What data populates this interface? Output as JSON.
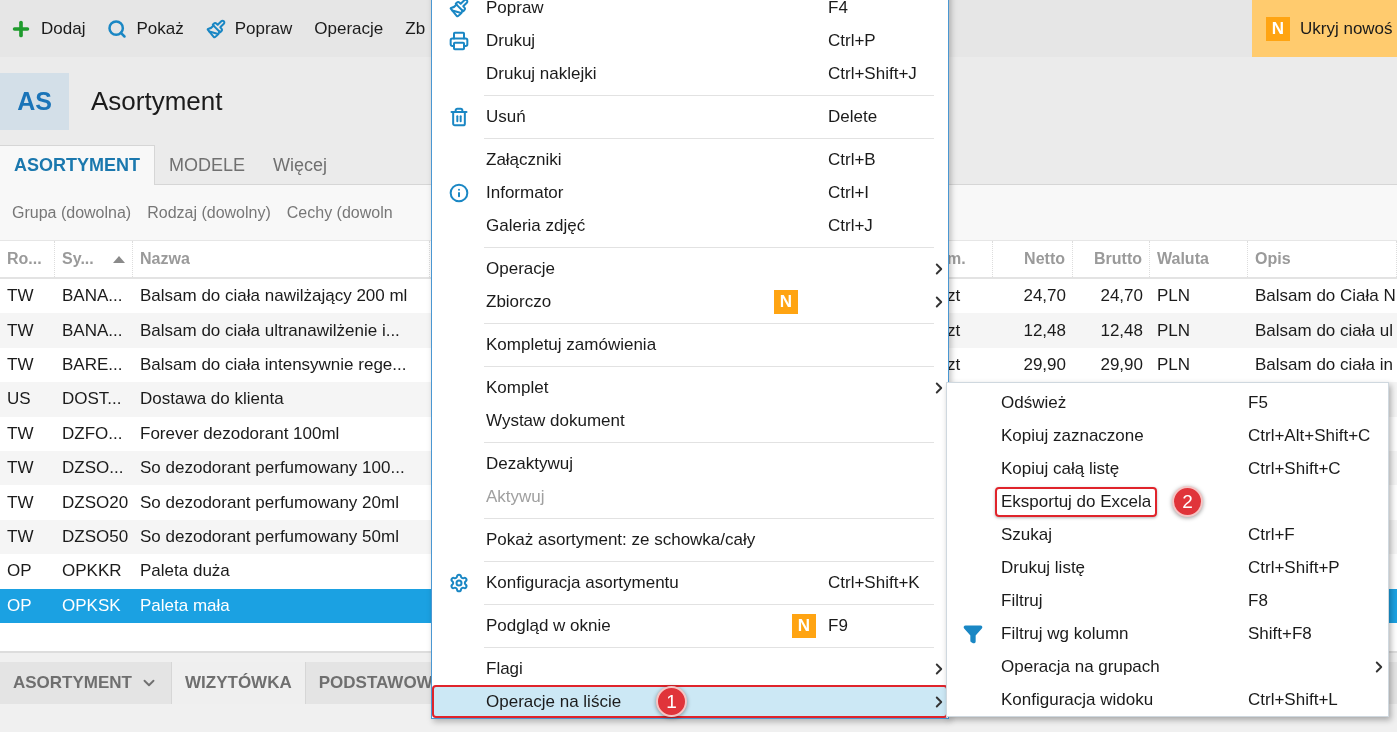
{
  "toolbar": {
    "items": [
      {
        "label": "Dodaj"
      },
      {
        "label": "Pokaż"
      },
      {
        "label": "Popraw"
      },
      {
        "label": "Operacje"
      },
      {
        "label": "Zb"
      }
    ],
    "news_button": {
      "badge": "N",
      "label": "Ukryj nowoś"
    }
  },
  "header": {
    "badge": "AS",
    "title": "Asortyment"
  },
  "tabs": [
    {
      "label": "ASORTYMENT",
      "selected": true
    },
    {
      "label": "MODELE",
      "selected": false
    },
    {
      "label": "Więcej",
      "selected": false
    }
  ],
  "filters": [
    "Grupa (dowolna)",
    "Rodzaj (dowolny)",
    "Cechy (dowoln"
  ],
  "table": {
    "columns": [
      {
        "label": "Ro...",
        "sorted": false
      },
      {
        "label": "Sy...",
        "sorted": true
      },
      {
        "label": "Nazwa",
        "sorted": false
      },
      {
        "label": "m.",
        "sorted": false
      },
      {
        "label": "Netto",
        "sorted": false
      },
      {
        "label": "Brutto",
        "sorted": false
      },
      {
        "label": "Waluta",
        "sorted": false
      },
      {
        "label": "Opis",
        "sorted": false
      }
    ],
    "rows": [
      {
        "selected": false,
        "cells": [
          "TW",
          "BANA...",
          "Balsam do ciała nawilżający 200 ml",
          "zt",
          "24,70",
          "24,70",
          "PLN",
          "Balsam do Ciała N"
        ]
      },
      {
        "selected": false,
        "cells": [
          "TW",
          "BANA...",
          "Balsam do ciała ultranawilżenie i...",
          "zt",
          "12,48",
          "12,48",
          "PLN",
          "Balsam do ciała ul"
        ]
      },
      {
        "selected": false,
        "cells": [
          "TW",
          "BARE...",
          "Balsam do ciała intensywnie rege...",
          "zt",
          "29,90",
          "29,90",
          "PLN",
          "Balsam do ciała in"
        ]
      },
      {
        "selected": false,
        "cells": [
          "US",
          "DOST...",
          "Dostawa do klienta"
        ]
      },
      {
        "selected": false,
        "cells": [
          "TW",
          "DZFO...",
          "Forever dezodorant 100ml"
        ]
      },
      {
        "selected": false,
        "cells": [
          "TW",
          "DZSO...",
          "So dezodorant perfumowany 100..."
        ]
      },
      {
        "selected": false,
        "cells": [
          "TW",
          "DZSO20",
          "So dezodorant perfumowany 20ml"
        ]
      },
      {
        "selected": false,
        "cells": [
          "TW",
          "DZSO50",
          "So dezodorant perfumowany 50ml"
        ]
      },
      {
        "selected": false,
        "cells": [
          "OP",
          "OPKKR",
          "Paleta duża"
        ]
      },
      {
        "selected": true,
        "cells": [
          "OP",
          "OPKSK",
          "Paleta mała"
        ]
      }
    ]
  },
  "bottom_tabs": [
    {
      "label": "ASORTYMENT",
      "dropdown": true,
      "selected": false
    },
    {
      "label": "WIZYTÓWKA",
      "dropdown": false,
      "selected": true
    },
    {
      "label": "PODSTAWOW",
      "dropdown": false,
      "selected": false
    }
  ],
  "context_menu": {
    "items": [
      {
        "kind": "item",
        "label": "Popraw",
        "shortcut": "F4",
        "submenu": false,
        "disabled": false,
        "highlighted": false,
        "outlined": false
      },
      {
        "kind": "item",
        "label": "Drukuj",
        "shortcut": "Ctrl+P",
        "submenu": false,
        "disabled": false,
        "highlighted": false,
        "outlined": false
      },
      {
        "kind": "item",
        "label": "Drukuj naklejki",
        "shortcut": "Ctrl+Shift+J",
        "submenu": false,
        "disabled": false,
        "highlighted": false,
        "outlined": false
      },
      {
        "kind": "separator"
      },
      {
        "kind": "item",
        "label": "Usuń",
        "shortcut": "Delete",
        "submenu": false,
        "disabled": false,
        "highlighted": false,
        "outlined": false
      },
      {
        "kind": "separator"
      },
      {
        "kind": "item",
        "label": "Załączniki",
        "shortcut": "Ctrl+B",
        "submenu": false,
        "disabled": false,
        "highlighted": false,
        "outlined": false
      },
      {
        "kind": "item",
        "label": "Informator",
        "shortcut": "Ctrl+I",
        "submenu": false,
        "disabled": false,
        "highlighted": false,
        "outlined": false
      },
      {
        "kind": "item",
        "label": "Galeria zdjęć",
        "shortcut": "Ctrl+J",
        "submenu": false,
        "disabled": false,
        "highlighted": false,
        "outlined": false
      },
      {
        "kind": "separator"
      },
      {
        "kind": "item",
        "label": "Operacje",
        "submenu": true,
        "disabled": false,
        "highlighted": false,
        "outlined": false
      },
      {
        "kind": "item",
        "label": "Zbiorczo",
        "badge": "N",
        "submenu": true,
        "disabled": false,
        "highlighted": false,
        "outlined": false
      },
      {
        "kind": "separator"
      },
      {
        "kind": "item",
        "label": "Kompletuj zamówienia",
        "submenu": false,
        "disabled": false,
        "highlighted": false,
        "outlined": false
      },
      {
        "kind": "separator"
      },
      {
        "kind": "item",
        "label": "Komplet",
        "submenu": true,
        "disabled": false,
        "highlighted": false,
        "outlined": false
      },
      {
        "kind": "item",
        "label": "Wystaw dokument",
        "submenu": false,
        "disabled": false,
        "highlighted": false,
        "outlined": false
      },
      {
        "kind": "separator"
      },
      {
        "kind": "item",
        "label": "Dezaktywuj",
        "submenu": false,
        "disabled": false,
        "highlighted": false,
        "outlined": false
      },
      {
        "kind": "item",
        "label": "Aktywuj",
        "submenu": false,
        "disabled": true,
        "highlighted": false,
        "outlined": false
      },
      {
        "kind": "separator"
      },
      {
        "kind": "item",
        "label": "Pokaż asortyment: ze schowka/cały",
        "submenu": false,
        "disabled": false,
        "highlighted": false,
        "outlined": false
      },
      {
        "kind": "separator"
      },
      {
        "kind": "item",
        "label": "Konfiguracja asortymentu",
        "shortcut": "Ctrl+Shift+K",
        "submenu": false,
        "disabled": false,
        "highlighted": false,
        "outlined": false
      },
      {
        "kind": "separator"
      },
      {
        "kind": "item",
        "label": "Podgląd w oknie",
        "shortcut": "F9",
        "badge": "N",
        "submenu": false,
        "disabled": false,
        "highlighted": false,
        "outlined": false
      },
      {
        "kind": "separator"
      },
      {
        "kind": "item",
        "label": "Flagi",
        "submenu": true,
        "disabled": false,
        "highlighted": false,
        "outlined": false
      },
      {
        "kind": "item",
        "label": "Operacje na liście",
        "submenu": true,
        "disabled": false,
        "highlighted": true,
        "outlined": true,
        "callout": "1"
      }
    ]
  },
  "submenu": {
    "items": [
      {
        "kind": "item",
        "label": "Odśwież",
        "shortcut": "F5",
        "submenu": false,
        "outlined": false
      },
      {
        "kind": "item",
        "label": "Kopiuj zaznaczone",
        "shortcut": "Ctrl+Alt+Shift+C",
        "submenu": false,
        "outlined": false
      },
      {
        "kind": "item",
        "label": "Kopiuj całą listę",
        "shortcut": "Ctrl+Shift+C",
        "submenu": false,
        "outlined": false
      },
      {
        "kind": "item",
        "label": "Eksportuj do Excela",
        "submenu": false,
        "outlined": true,
        "callout": "2"
      },
      {
        "kind": "item",
        "label": "Szukaj",
        "shortcut": "Ctrl+F",
        "submenu": false,
        "outlined": false
      },
      {
        "kind": "item",
        "label": "Drukuj listę",
        "shortcut": "Ctrl+Shift+P",
        "submenu": false,
        "outlined": false
      },
      {
        "kind": "item",
        "label": "Filtruj",
        "shortcut": "F8",
        "submenu": false,
        "outlined": false
      },
      {
        "kind": "item",
        "label": "Filtruj wg kolumn",
        "shortcut": "Shift+F8",
        "submenu": false,
        "outlined": false
      },
      {
        "kind": "item",
        "label": "Operacja na grupach",
        "submenu": true,
        "outlined": false
      },
      {
        "kind": "item",
        "label": "Konfiguracja widoku",
        "shortcut": "Ctrl+Shift+L",
        "submenu": false,
        "outlined": false
      }
    ]
  }
}
